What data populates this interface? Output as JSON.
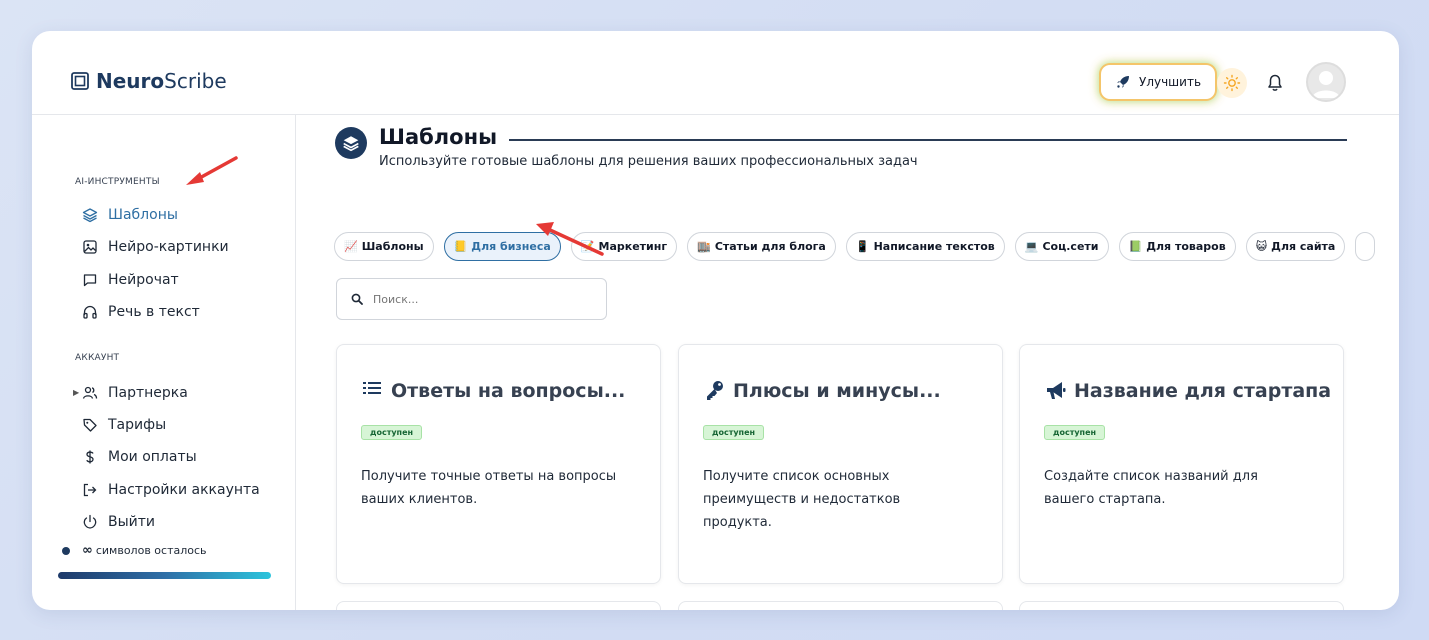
{
  "brand": {
    "name_bold": "Neuro",
    "name_rest": "Scribe"
  },
  "header": {
    "upgrade_label": "Улучшить"
  },
  "sidebar": {
    "section_tools": "AI-инструменты",
    "tools": [
      {
        "label": "Шаблоны",
        "icon": "layers-icon",
        "active": true
      },
      {
        "label": "Нейро-картинки",
        "icon": "image-icon"
      },
      {
        "label": "Нейрочат",
        "icon": "chat-icon"
      },
      {
        "label": "Речь в текст",
        "icon": "headphones-icon"
      }
    ],
    "section_account": "Аккаунт",
    "account": [
      {
        "label": "Партнерка",
        "icon": "users-icon"
      },
      {
        "label": "Тарифы",
        "icon": "tag-icon"
      },
      {
        "label": "Мои оплаты",
        "icon": "dollar-icon"
      },
      {
        "label": "Настройки аккаунта",
        "icon": "login-icon"
      },
      {
        "label": "Выйти",
        "icon": "power-icon"
      }
    ],
    "credits": {
      "symbol": "∞",
      "text": "символов осталось"
    }
  },
  "main": {
    "title": "Шаблоны",
    "subtitle": "Используйте готовые шаблоны для решения ваших профессиональных задач",
    "chips": [
      {
        "label": "Шаблоны",
        "emoji": "📈"
      },
      {
        "label": "Для бизнеса",
        "emoji": "📒",
        "active": true
      },
      {
        "label": "Маркетинг",
        "emoji": "📝"
      },
      {
        "label": "Статьи для блога",
        "emoji": "🏬"
      },
      {
        "label": "Написание текстов",
        "emoji": "📱"
      },
      {
        "label": "Соц.сети",
        "emoji": "💻"
      },
      {
        "label": "Для товаров",
        "emoji": "📗"
      },
      {
        "label": "Для сайта",
        "emoji": "😺"
      }
    ],
    "search_placeholder": "Поиск...",
    "cards": [
      {
        "title": "Ответы на вопросы...",
        "badge": "доступен",
        "desc": "Получите точные ответы на вопросы ваших клиентов.",
        "icon": "list-icon"
      },
      {
        "title": "Плюсы и минусы...",
        "badge": "доступен",
        "desc": "Получите список основных преимуществ и недостатков продукта.",
        "icon": "key-icon"
      },
      {
        "title": "Название для стартапа",
        "badge": "доступен",
        "desc": "Создайте список названий для вашего стартапа.",
        "icon": "megaphone-icon"
      }
    ]
  },
  "colors": {
    "accent": "#2f6fa3",
    "brand": "#1e3a5f",
    "badge_bg": "#d7f5d6",
    "arrow": "#e53935"
  }
}
